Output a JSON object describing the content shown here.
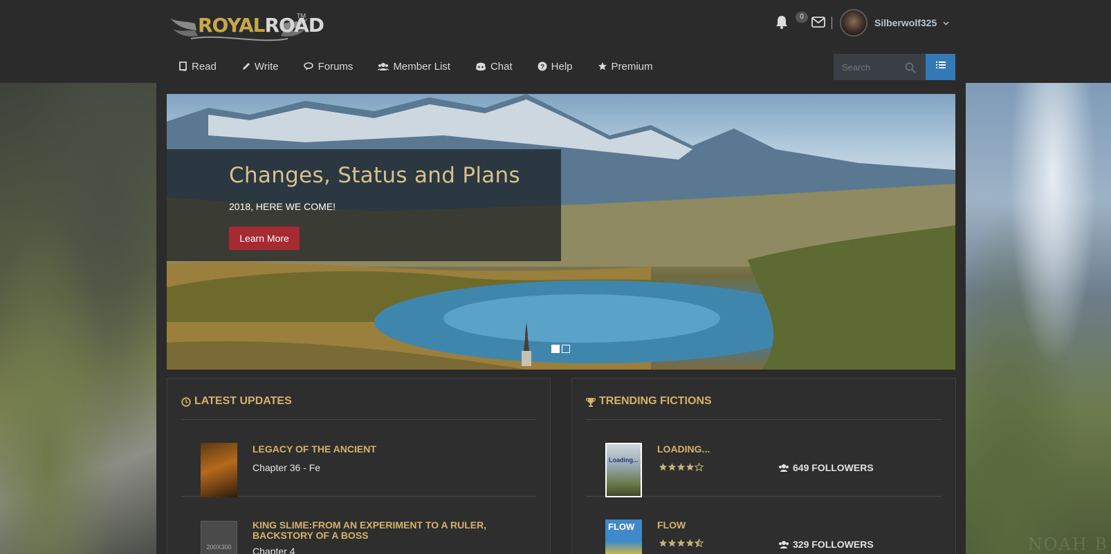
{
  "header": {
    "logo": "ROYALROAD",
    "logo_royal": "ROYAL",
    "logo_road": "ROAD",
    "logo_tm": "TM",
    "notification_count": "0",
    "username": "Silberwolf325"
  },
  "nav": [
    {
      "label": "Read",
      "icon": "book-icon"
    },
    {
      "label": "Write",
      "icon": "pencil-icon"
    },
    {
      "label": "Forums",
      "icon": "comments-icon"
    },
    {
      "label": "Member List",
      "icon": "users-icon"
    },
    {
      "label": "Chat",
      "icon": "discord-icon"
    },
    {
      "label": "Help",
      "icon": "question-circle-icon"
    },
    {
      "label": "Premium",
      "icon": "star-icon"
    }
  ],
  "search": {
    "placeholder": "Search"
  },
  "carousel": {
    "title": "Changes, Status and Plans",
    "subtitle": "2018, HERE WE COME!",
    "button_label": "Learn More",
    "slide_count": 2,
    "active_slide": 1
  },
  "latest_updates": {
    "heading": "LATEST UPDATES",
    "items": [
      {
        "title": "LEGACY OF THE ANCIENT",
        "chapter": "Chapter 36 - Fe"
      },
      {
        "title": "KING SLIME:FROM AN EXPERIMENT TO A RULER, BACKSTORY OF A BOSS",
        "chapter": "Chapter 4",
        "thumb_text": "200X300"
      }
    ]
  },
  "trending": {
    "heading": "TRENDING FICTIONS",
    "items": [
      {
        "title": "LOADING...",
        "rating": 4.5,
        "followers": "649 FOLLOWERS",
        "thumb_text": "Loading..."
      },
      {
        "title": "FLOW",
        "rating": 4.5,
        "followers": "329 FOLLOWERS",
        "thumb_text": "FLOW"
      }
    ]
  },
  "watermark": "NOAH B",
  "colors": {
    "accent_gold": "#d6b36c",
    "button_red": "#a52a31",
    "menu_blue": "#337ab7",
    "background": "#2b2b2b"
  }
}
